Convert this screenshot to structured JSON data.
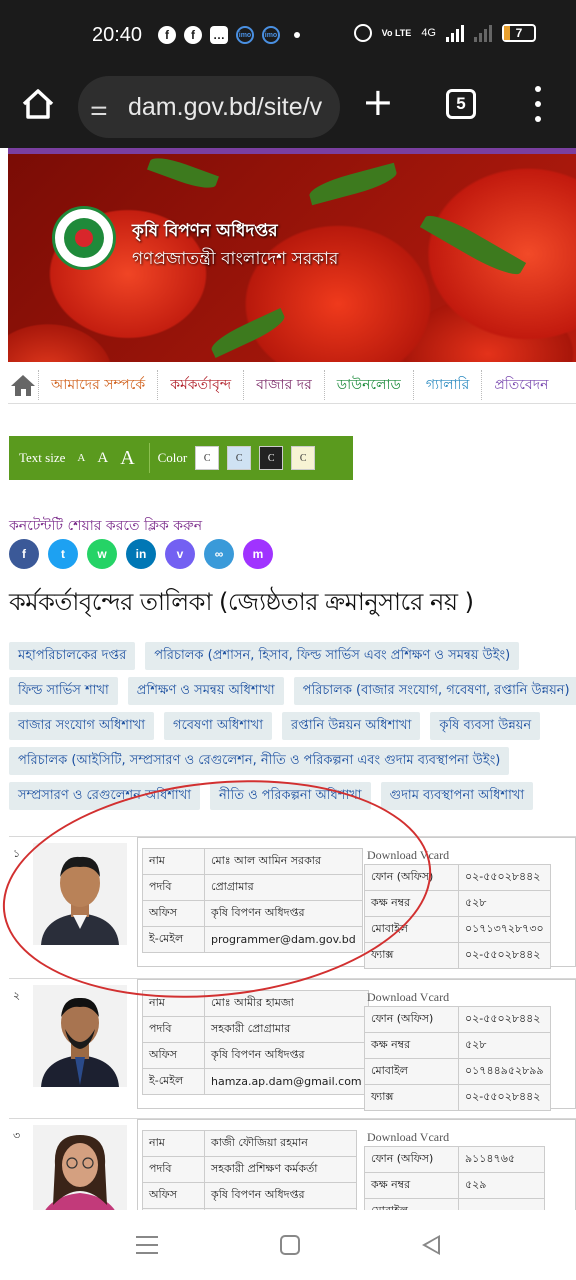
{
  "status_bar": {
    "time": "20:40",
    "network": "4G",
    "volte": "Vo LTE",
    "battery": "7"
  },
  "browser": {
    "url": "dam.gov.bd/site/v",
    "tab_count": "5"
  },
  "banner": {
    "title": "কৃষি বিপণন অধিদপ্তর",
    "subtitle": "গণপ্রজাতন্ত্রী বাংলাদেশ সরকার"
  },
  "nav": {
    "items": [
      "আমাদের সম্পর্কে",
      "কর্মকর্তাবৃন্দ",
      "বাজার দর",
      "ডাউনলোড",
      "গ্যালারি",
      "প্রতিবেদন"
    ]
  },
  "access": {
    "text_size_label": "Text size",
    "size_small": "A",
    "size_medium": "A",
    "size_large": "A",
    "color_label": "Color",
    "color_options": [
      "C",
      "C",
      "C",
      "C"
    ]
  },
  "share": {
    "label": "কনটেন্টটি শেয়ার করতে ক্লিক করুন",
    "buttons": [
      {
        "icon": "facebook-icon",
        "glyph": "f",
        "color": "#3b5998"
      },
      {
        "icon": "twitter-icon",
        "glyph": "t",
        "color": "#1da1f2"
      },
      {
        "icon": "whatsapp-icon",
        "glyph": "w",
        "color": "#25d366"
      },
      {
        "icon": "linkedin-icon",
        "glyph": "in",
        "color": "#0077b5"
      },
      {
        "icon": "viber-icon",
        "glyph": "v",
        "color": "#7360f2"
      },
      {
        "icon": "link-icon",
        "glyph": "∞",
        "color": "#3a9ad9"
      },
      {
        "icon": "messenger-icon",
        "glyph": "m",
        "color": "#a033ff"
      }
    ]
  },
  "page_title": "কর্মকর্তাবৃন্দের তালিকা (জ্যেষ্ঠতার ক্রমানুসারে নয় )",
  "tags": [
    [
      "মহাপরিচালকের দপ্তর",
      "পরিচালক (প্রশাসন, হিসাব, ফিল্ড সার্ভিস এবং প্রশিক্ষণ ও সমন্বয় উইং)"
    ],
    [
      "ফিল্ড সার্ভিস শাখা",
      "প্রশিক্ষণ ও সমন্বয় অধিশাখা",
      "পরিচালক (বাজার সংযোগ, গবেষণা, রপ্তানি উন্নয়ন)"
    ],
    [
      "বাজার সংযোগ অধিশাখা",
      "গবেষণা অধিশাখা",
      "রপ্তানি উন্নয়ন অধিশাখা",
      "কৃষি ব্যবসা উন্নয়ন"
    ],
    [
      "পরিচালক (আইসিটি, সম্প্রসারণ ও রেগুলেশন, নীতি ও পরিকল্পনা এবং গুদাম ব্যবস্থাপনা উইং)"
    ],
    [
      "সম্প্রসারণ ও রেগুলেশন অধিশাখা",
      "নীতি ও পরিকল্পনা অধিশাখা",
      "গুদাম ব্যবস্থাপনা অধিশাখা"
    ]
  ],
  "labels": {
    "name": "নাম",
    "designation": "পদবি",
    "office": "অফিস",
    "email": "ই-মেইল",
    "download_vcard": "Download Vcard",
    "phone_office": "ফোন (অফিস)",
    "room": "কক্ষ নম্বর",
    "mobile": "মোবাইল",
    "fax": "ফ্যাক্স"
  },
  "staff": [
    {
      "serial": "১",
      "name": "মোঃ আল আমিন সরকার",
      "designation": "প্রোগ্রামার",
      "office": "কৃষি বিপণন অধিদপ্তর",
      "email": "programmer@dam.gov.bd",
      "phone_office": "০২-৫৫০২৮৪৪২",
      "room": "৫২৮",
      "mobile": "০১৭১৩৭২৮৭৩০",
      "fax": "০২-৫৫০২৮৪৪২"
    },
    {
      "serial": "২",
      "name": "মোঃ আমীর হামজা",
      "designation": "সহকারী প্রোগ্রামার",
      "office": "কৃষি বিপণন অধিদপ্তর",
      "email": "hamza.ap.dam@gmail.com",
      "phone_office": "০২-৫৫০২৮৪৪২",
      "room": "৫২৮",
      "mobile": "০১৭৪৪৯৫২৮৯৯",
      "fax": "০২-৫৫০২৮৪৪২"
    },
    {
      "serial": "৩",
      "name": "কাজী ফৌজিয়া রহমান",
      "designation": "সহকারী প্রশিক্ষণ কর্মকর্তা",
      "office": "কৃষি বিপণন অধিদপ্তর",
      "email": "",
      "phone_office": "৯১১৪৭৬৫",
      "room": "৫২৯",
      "mobile": "",
      "fax": ""
    }
  ]
}
